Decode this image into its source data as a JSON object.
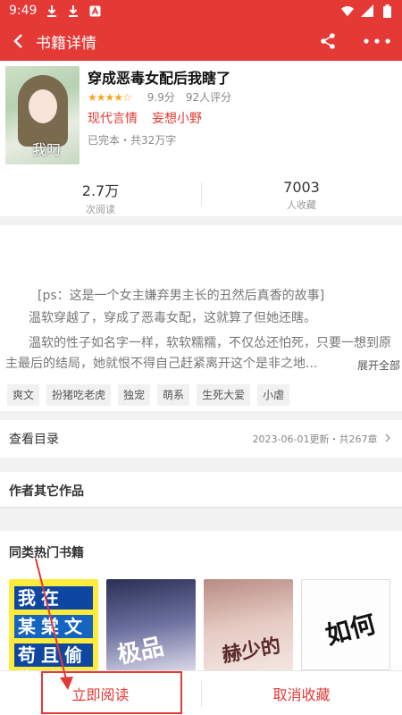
{
  "status_bar": {
    "time": "9:49"
  },
  "app_bar": {
    "title": "书籍详情"
  },
  "book": {
    "cover_text": "我叼",
    "title": "穿成恶毒女配后我瞎了",
    "score": "9.9分",
    "rating_count": "92人评分",
    "stars": 4.5,
    "category": "现代言情",
    "author": "妄想小野",
    "status": "已完本・共32万字",
    "reads_value": "2.7万",
    "reads_label": "次阅读",
    "collects_value": "7003",
    "collects_label": "人收藏"
  },
  "intro": {
    "line1": "[ps：这是一个女主嫌弃男主长的丑然后真香的故事]",
    "line2": "温软穿越了，穿成了恶毒女配，这就算了但她还瞎。",
    "line3": "温软的性子如名字一样，软软糯糯，不仅怂还怕死，只要一想到原主最后的结局，她就恨不得自己赶紧离开这个是非之地...",
    "expand": "展开全部",
    "tags": [
      "爽文",
      "扮猪吃老虎",
      "独宠",
      "萌系",
      "生死大爱",
      "小虐"
    ]
  },
  "toc": {
    "label": "查看目录",
    "meta": "2023-06-01更新・共267章"
  },
  "author_works": {
    "title": "作者其它作品"
  },
  "similar": {
    "title": "同类热门书籍",
    "book1_line1": "我在",
    "book1_line2": "某棠文",
    "book1_line3": "苟且偷生",
    "book2_text": "极品",
    "book3_text": "赫少的",
    "book4_text": "如何"
  },
  "bottom": {
    "read": "立即阅读",
    "cancel": "取消收藏"
  },
  "colors": {
    "accent": "#e53935",
    "star": "#f5a623"
  }
}
